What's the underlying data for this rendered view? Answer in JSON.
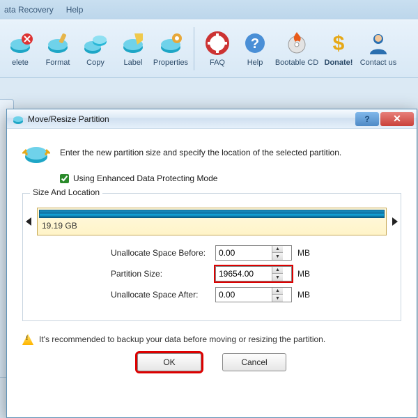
{
  "menu": {
    "item1": "ata Recovery",
    "item2": "Help"
  },
  "toolbar": {
    "items": [
      {
        "label": "elete",
        "icon": "disk-red"
      },
      {
        "label": "Format",
        "icon": "disk-brush"
      },
      {
        "label": "Copy",
        "icon": "disk-copy"
      },
      {
        "label": "Label",
        "icon": "disk-label"
      },
      {
        "label": "Properties",
        "icon": "disk-gear"
      }
    ],
    "group2": [
      {
        "label": "FAQ",
        "icon": "lifesaver"
      },
      {
        "label": "Help",
        "icon": "question"
      },
      {
        "label": "Bootable CD",
        "icon": "cd-fire"
      },
      {
        "label": "Donate!",
        "icon": "dollar",
        "bold": true
      },
      {
        "label": "Contact us",
        "icon": "person"
      }
    ]
  },
  "dialog": {
    "title": "Move/Resize Partition",
    "intro": "Enter the new partition size and specify the location of the selected partition.",
    "checkbox_label": "Using Enhanced Data Protecting Mode",
    "checkbox_checked": true,
    "group_label": "Size And Location",
    "bar": {
      "text": "19.19 GB"
    },
    "fields": {
      "before_label": "Unallocate Space Before:",
      "before_value": "0.00",
      "size_label": "Partition Size:",
      "size_value": "19654.00",
      "after_label": "Unallocate Space After:",
      "after_value": "0.00",
      "unit": "MB"
    },
    "warning": "It's recommended to backup your data before moving or resizing the partition.",
    "ok": "OK",
    "cancel": "Cancel"
  }
}
